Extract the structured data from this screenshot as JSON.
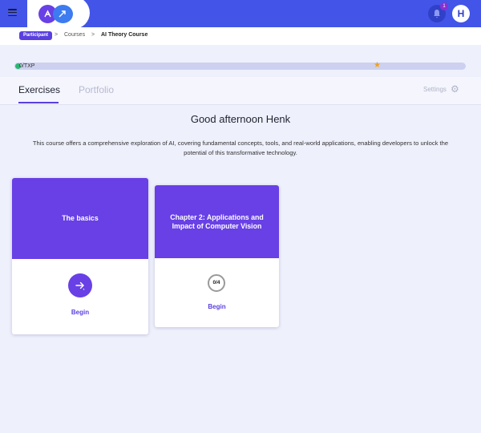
{
  "topbar": {
    "notification_count": "1",
    "avatar_initial": "H"
  },
  "breadcrumb": {
    "role_badge": "Participant",
    "items": [
      "Courses",
      "AI Theory Course"
    ],
    "separator": ">"
  },
  "progress": {
    "label": "0/TXP",
    "value": 0
  },
  "tabs": [
    {
      "label": "Exercises",
      "active": true
    },
    {
      "label": "Portfolio",
      "active": false
    }
  ],
  "settings_label": "Settings",
  "greeting": "Good afternoon Henk",
  "description": "This course offers a comprehensive exploration of AI, covering fundamental concepts, tools, and real-world applications, enabling developers to unlock the potential of this transformative technology.",
  "cards": [
    {
      "title": "The basics",
      "action": "Begin",
      "icon": "arrow-right-icon"
    },
    {
      "title": "Chapter 2: Applications and Impact of Computer Vision",
      "progress": "0/4",
      "action": "Begin"
    }
  ],
  "colors": {
    "topbar": "#4255e8",
    "accent": "#6840e6",
    "page_bg": "#eef0fc"
  }
}
